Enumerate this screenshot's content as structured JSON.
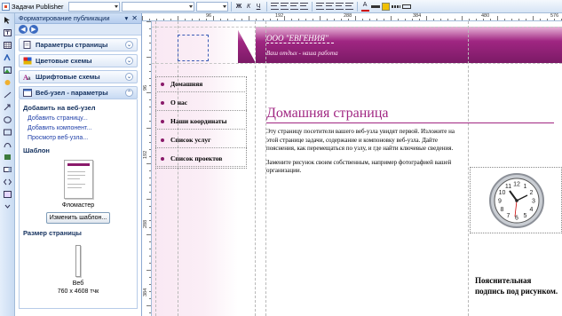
{
  "toolbar": {
    "task_label": "Задачи Publisher"
  },
  "task_pane": {
    "title": "Форматирование публикации",
    "sections": [
      {
        "label": "Параметры страницы"
      },
      {
        "label": "Цветовые схемы"
      },
      {
        "label": "Шрифтовые схемы"
      },
      {
        "label": "Веб-узел - параметры"
      }
    ],
    "add_header": "Добавить на веб-узел",
    "links": [
      "Добавить страницу...",
      "Добавить компонент...",
      "Просмотр веб-узла..."
    ],
    "template_header": "Шаблон",
    "template_name": "Фломастер",
    "change_template_button": "Изменить шаблон...",
    "page_size_header": "Размер страницы",
    "page_size_name": "Веб",
    "page_size_value": "760 x 4608 тчк"
  },
  "rulers": {
    "h_labels": [
      "96",
      "192",
      "288",
      "384",
      "480",
      "576"
    ],
    "v_labels": [
      "96",
      "192",
      "288",
      "384"
    ]
  },
  "document": {
    "org_name": "ООО \"ЕВГЕНИЯ\"",
    "slogan": "Ваш отдых - наша работа",
    "nav_items": [
      "Домашняя",
      "О нас",
      "Наши координаты",
      "Список услуг",
      "Список проектов"
    ],
    "headline": "Домашняя страница",
    "paragraph1": "Эту страницу посетители вашего веб-узла увидят первой. Изложите на этой странице задачи, содержание и компоновку веб-узла. Дайте пояснения, как перемещаться по узлу, и где найти ключевые сведения.",
    "paragraph2": "Замените рисунок своим собственным, например фотографией вашей организации.",
    "caption": "Пояснительная подпись под рисунком.",
    "clock_numerals": [
      "12",
      "1",
      "2",
      "3",
      "4",
      "5",
      "6",
      "7",
      "8",
      "9",
      "10",
      "11"
    ]
  },
  "colors": {
    "accent": "#a02682",
    "nav_bullet": "#8a1a6a"
  }
}
